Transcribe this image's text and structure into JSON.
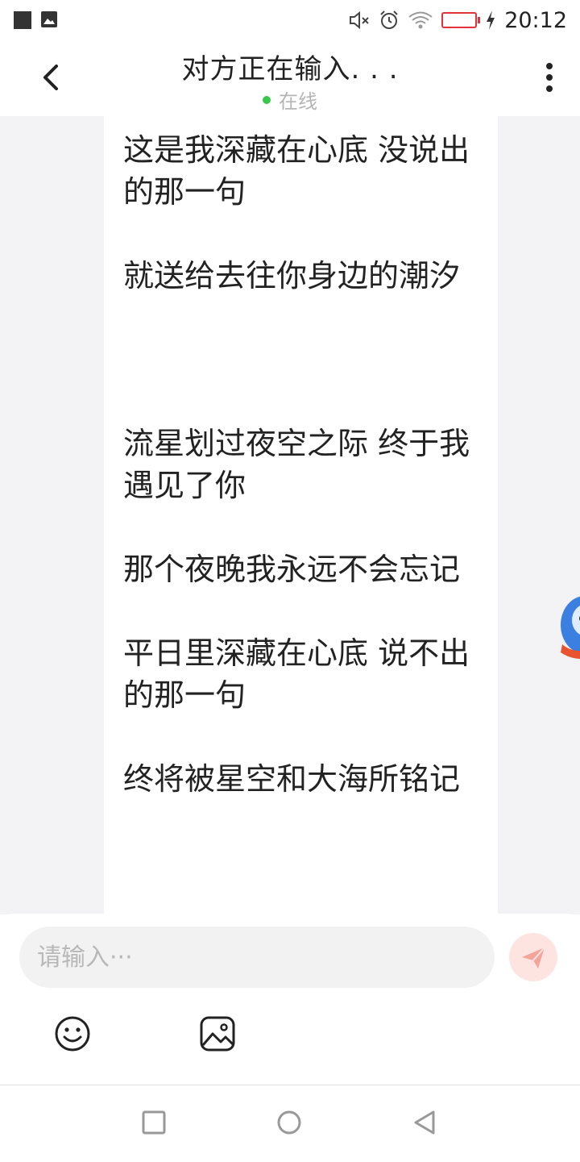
{
  "status_bar": {
    "time": "20:12",
    "icons": [
      "notification-square-icon",
      "gallery-notification-icon",
      "mute-icon",
      "alarm-icon",
      "wifi-icon",
      "battery-low-icon",
      "charging-icon"
    ],
    "battery_color": "#e3323b"
  },
  "header": {
    "title": "对方正在输入. . .",
    "status": "在线",
    "status_dot_color": "#37c74b"
  },
  "message": {
    "lines": [
      "这是我深藏在心底  没说出的那一句",
      "就送给去往你身边的潮汐",
      "流星划过夜空之际  终于我遇见了你",
      "那个夜晚我永远不会忘记",
      "平日里深藏在心底  说不出的那一句",
      "终将被星空和大海所铭记"
    ]
  },
  "composer": {
    "placeholder": "请输入···",
    "send_color": "#fde4e1"
  },
  "nav_bar": {
    "icons": [
      "recent-apps-icon",
      "home-icon",
      "back-triangle-icon"
    ]
  }
}
